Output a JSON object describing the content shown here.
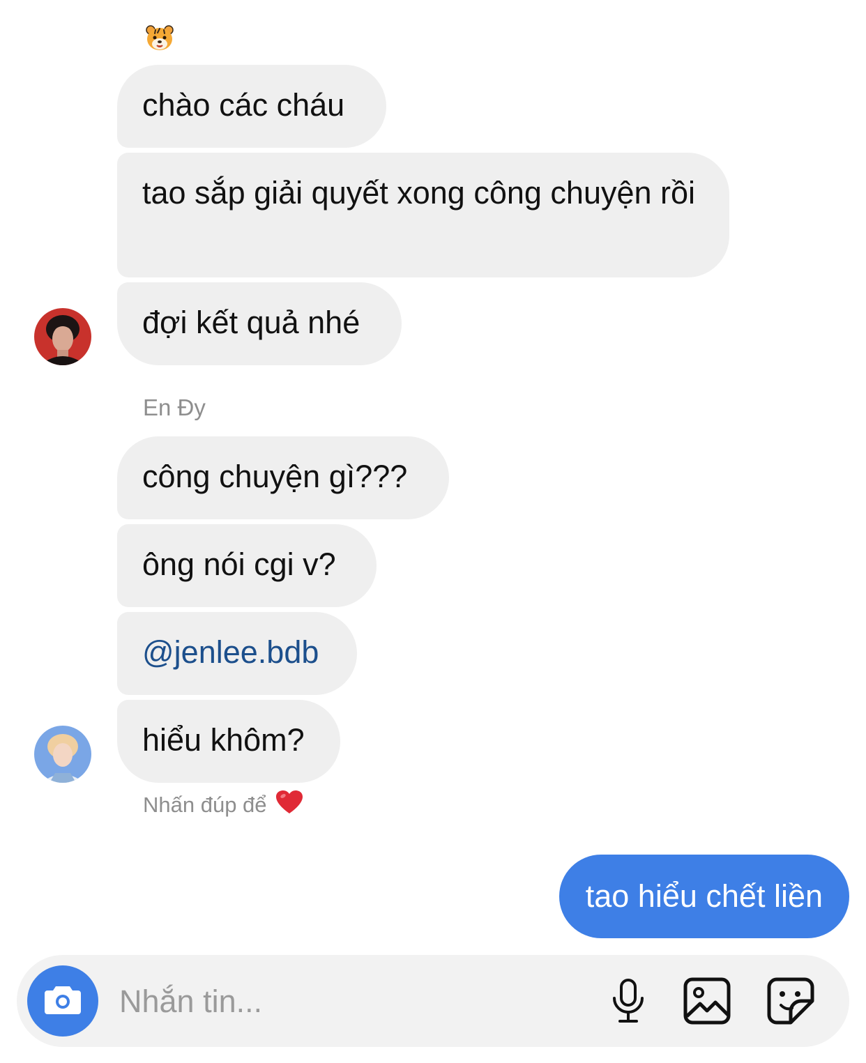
{
  "thread": {
    "messages": [
      {
        "text": "chào các cháu"
      },
      {
        "text": "tao sắp giải quyết xong công chuyện rồi"
      },
      {
        "text": "đợi kết quả nhé"
      },
      {
        "text": "công chuyện gì???"
      },
      {
        "text": "ông nói cgi v?"
      },
      {
        "text": "@jenlee.bdb"
      },
      {
        "text": "hiểu khôm?"
      }
    ],
    "sender_name": "En Đy",
    "like_hint": "Nhấn đúp để",
    "my_message": "tao hiểu chết liền"
  },
  "composer": {
    "placeholder": "Nhắn tin..."
  },
  "icons": {
    "top_emoji": "tiger-face-icon",
    "hint_emoji": "red-heart-icon",
    "camera": "camera-icon",
    "mic": "microphone-icon",
    "gallery": "image-gallery-icon",
    "sticker": "sticker-icon"
  },
  "colors": {
    "accent": "#3e7fe6",
    "bubble": "#efefef",
    "mention": "#1c4f8c",
    "meta_text": "#8e8e8e"
  }
}
